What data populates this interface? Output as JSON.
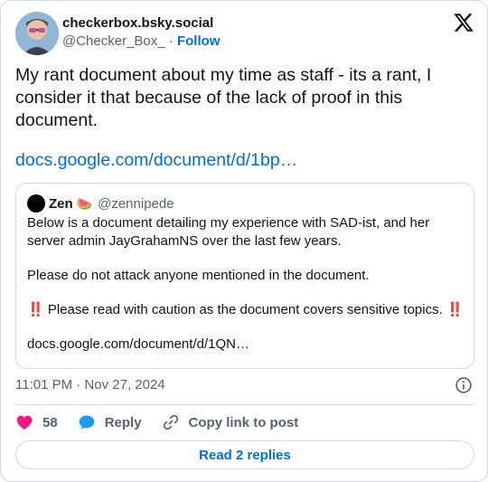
{
  "author": {
    "display_name": "checkerbox.bsky.social",
    "handle": "@Checker_Box_",
    "separator": "·",
    "follow_label": "Follow",
    "avatar_icon": "avatar-image"
  },
  "tweet": {
    "text": "My rant document about my time as staff - its a rant, I consider it that because of the lack of proof in this document.",
    "link": "docs.google.com/document/d/1bp…"
  },
  "quote": {
    "name": "Zen",
    "emoji": "🍉",
    "handle": "@zennipede",
    "para1": "Below is a document detailing my experience with SAD-ist, and her server admin JayGrahamNS over the last few years.",
    "para2": "Please do not attack anyone mentioned in the document.",
    "para3_prefix": "‼️",
    "para3": "Please read with caution as the document covers sensitive topics.",
    "para3_suffix": "‼️",
    "link": "docs.google.com/document/d/1QN…"
  },
  "meta": {
    "timestamp": "11:01 PM · Nov 27, 2024"
  },
  "actions": {
    "likes": "58",
    "reply_label": "Reply",
    "copy_label": "Copy link to post"
  },
  "footer": {
    "read_replies_label": "Read 2 replies"
  },
  "colors": {
    "link": "#006fd6",
    "like": "#f91880",
    "reply": "#1d9bf0",
    "border": "#cfd9de"
  }
}
